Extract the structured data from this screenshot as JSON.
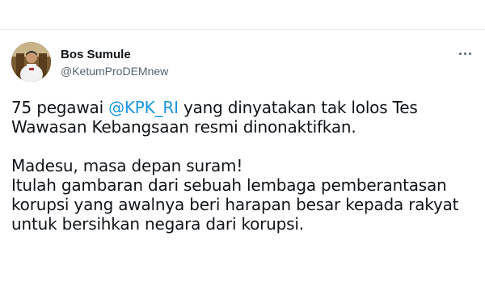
{
  "author": {
    "display_name": "Bos Sumule",
    "handle": "@KetumProDEMnew"
  },
  "icons": {
    "more": "more-horizontal-icon",
    "avatar": "profile-photo"
  },
  "colors": {
    "mention": "#1b95e0",
    "text": "#0f1419",
    "secondary": "#536471"
  },
  "tweet": {
    "line1_pre": "75 pegawai ",
    "line1_mention": "@KPK_RI",
    "line1_post": " yang dinyatakan tak lolos Tes",
    "line2": "Wawasan Kebangsaan resmi dinonaktifkan.",
    "line3": "Madesu, masa depan suram!",
    "line4": "Itulah gambaran dari sebuah lembaga pemberantasan",
    "line5": "korupsi yang awalnya beri harapan besar kepada rakyat",
    "line6": "untuk bersihkan negara dari korupsi."
  }
}
